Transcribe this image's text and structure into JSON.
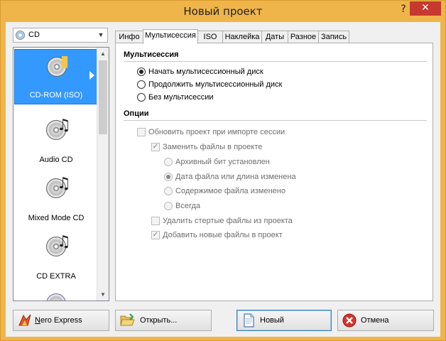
{
  "window": {
    "title": "Новый проект",
    "help_glyph": "?",
    "close_glyph": "✕"
  },
  "combo": {
    "value": "CD"
  },
  "categories": [
    {
      "label": "CD-ROM (ISO)",
      "selected": true
    },
    {
      "label": "Audio CD"
    },
    {
      "label": "Mixed Mode CD"
    },
    {
      "label": "CD EXTRA"
    }
  ],
  "tabs": [
    {
      "label": "Инфо"
    },
    {
      "label": "Мультисессия",
      "active": true
    },
    {
      "label": "ISO"
    },
    {
      "label": "Наклейка"
    },
    {
      "label": "Даты"
    },
    {
      "label": "Разное"
    },
    {
      "label": "Запись"
    }
  ],
  "multisession": {
    "title": "Мультисессия",
    "options": [
      {
        "label": "Начать мультисессионный диск",
        "checked": true
      },
      {
        "label": "Продолжить мультисессионный диск",
        "checked": false
      },
      {
        "label": "Без мультисессии",
        "checked": false
      }
    ]
  },
  "options": {
    "title": "Опции",
    "update_on_import": {
      "label": "Обновить проект при импорте сессии",
      "checked": false
    },
    "replace_files": {
      "label": "Заменить файлы в проекте",
      "checked": true
    },
    "replace_modes": [
      {
        "label": "Архивный бит установлен",
        "checked": false
      },
      {
        "label": "Дата файла или длина изменена",
        "checked": true
      },
      {
        "label": "Содержимое файла изменено",
        "checked": false
      },
      {
        "label": "Всегда",
        "checked": false
      }
    ],
    "delete_erased": {
      "label": "Удалить стертые файлы из проекта",
      "checked": false
    },
    "add_new": {
      "label": "Добавить новые файлы в проект",
      "checked": true
    }
  },
  "buttons": {
    "nero_express_first": "N",
    "nero_express_rest": "ero Express",
    "open": "Открыть...",
    "new": "Новый",
    "cancel": "Отмена"
  },
  "icons": {
    "combo": "cd-disc-icon",
    "note": "♫"
  }
}
